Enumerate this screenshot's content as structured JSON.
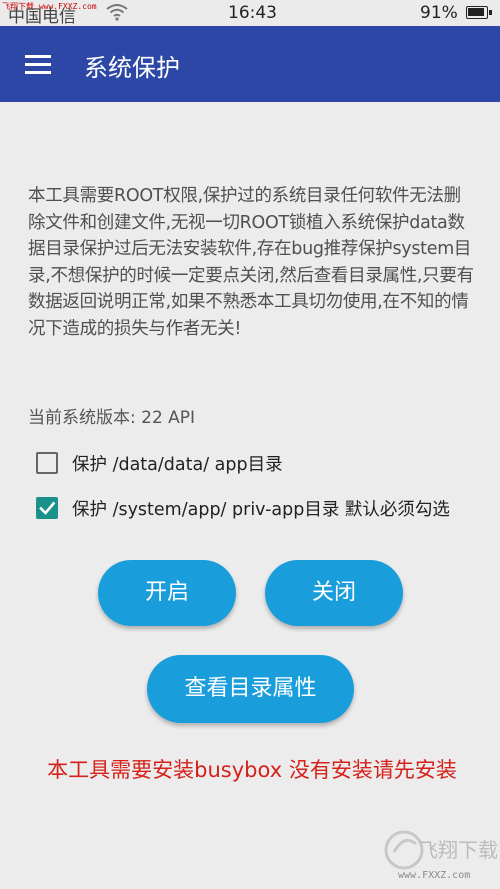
{
  "status_bar": {
    "watermark": "飞翔下载 www.FXXZ.com",
    "carrier": "中国电信",
    "time": "16:43",
    "battery": "91%"
  },
  "app_bar": {
    "title": "系统保护"
  },
  "main": {
    "description": "本工具需要ROOT权限,保护过的系统目录任何软件无法删除文件和创建文件,无视一切ROOT锁植入系统保护data数据目录保护过后无法安装软件,存在bug推荐保护system目录,不想保护的时候一定要点关闭,然后查看目录属性,只要有数据返回说明正常,如果不熟悉本工具切勿使用,在不知的情况下造成的损失与作者无关!",
    "version": "当前系统版本: 22 API",
    "checkboxes": [
      {
        "label": "保护 /data/data/ app目录",
        "checked": false
      },
      {
        "label": "保护 /system/app/ priv-app目录 默认必须勾选",
        "checked": true
      }
    ],
    "buttons": {
      "open": "开启",
      "close": "关闭",
      "view": "查看目录属性"
    },
    "warning": "本工具需要安装busybox 没有安装请先安装"
  },
  "watermark": {
    "text": "飞翔下载",
    "url": "www.FXXZ.com"
  },
  "colors": {
    "app_bar": "#2c47a5",
    "button": "#1a9edb",
    "checkbox_checked": "#19918a",
    "warning": "#d6201a"
  }
}
